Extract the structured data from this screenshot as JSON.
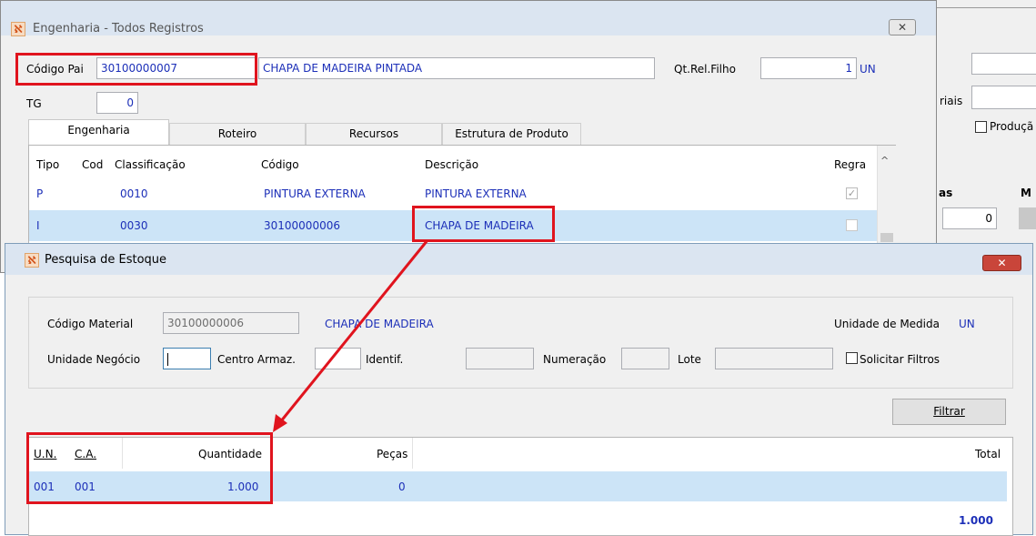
{
  "colors": {
    "accent_blue": "#1c2fb8",
    "highlight": "#e0141e",
    "selected_row": "#cce4f7"
  },
  "back_window": {
    "labels": [
      "riais"
    ],
    "checkbox_label": "Produçã",
    "col_header_1": "as",
    "col_header_2": "M",
    "value": "0"
  },
  "eng_window": {
    "title": "Engenharia - Todos Registros",
    "codigo_pai_label": "Código Pai",
    "codigo_pai_value": "30100000007",
    "descricao_value": "CHAPA DE MADEIRA PINTADA",
    "qt_label": "Qt.Rel.Filho",
    "qt_value": "1",
    "qt_unit": "UN",
    "tg_label": "TG",
    "tg_value": "0",
    "tabs": [
      "Engenharia",
      "Roteiro",
      "Recursos",
      "Estrutura de Produto"
    ],
    "columns": [
      "Tipo",
      "Cod",
      "Classificação",
      "Código",
      "Descrição",
      "Regra"
    ],
    "rows": [
      {
        "tipo": "P",
        "cod": "",
        "classificacao": "0010",
        "codigo": "PINTURA EXTERNA",
        "descricao": "PINTURA EXTERNA",
        "regra": true
      },
      {
        "tipo": "I",
        "cod": "",
        "classificacao": "0030",
        "codigo": "30100000006",
        "descricao": "CHAPA DE MADEIRA",
        "regra": false
      }
    ]
  },
  "stock_window": {
    "title": "Pesquisa de Estoque",
    "codigo_material_label": "Código Material",
    "codigo_material_value": "30100000006",
    "material_desc": "CHAPA DE MADEIRA",
    "unidade_medida_label": "Unidade de Medida",
    "unidade_medida_value": "UN",
    "unidade_negocio_label": "Unidade Negócio",
    "unidade_negocio_value": "",
    "centro_armaz_label": "Centro Armaz.",
    "identif_label": "Identif.",
    "numeracao_label": "Numeração",
    "lote_label": "Lote",
    "solicitar_filtros_label": "Solicitar Filtros",
    "filtrar_label": "Filtrar",
    "columns": [
      "U.N.",
      "C.A.",
      "Quantidade",
      "Peças",
      "Total"
    ],
    "rows": [
      {
        "un": "001",
        "ca": "001",
        "quantidade": "1.000",
        "pecas": "0",
        "total": ""
      }
    ],
    "total_value": "1.000"
  }
}
